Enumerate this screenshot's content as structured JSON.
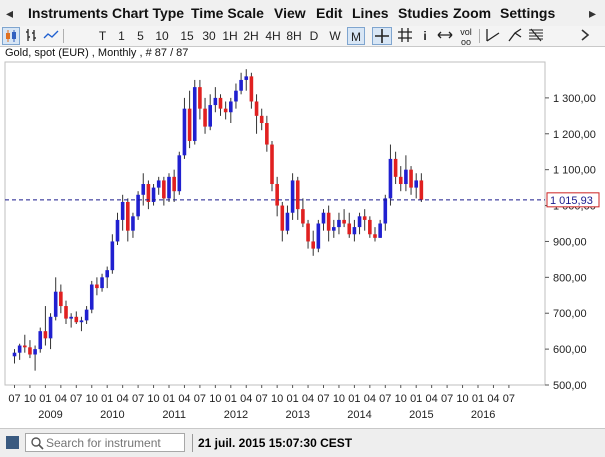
{
  "menu": {
    "items": [
      "Instruments",
      "Chart Type",
      "Time Scale",
      "View",
      "Edit",
      "Lines",
      "Studies",
      "Zoom",
      "Settings"
    ],
    "scroll_arrows": [
      "◂",
      "▸"
    ]
  },
  "toolbar": {
    "periods": [
      "T",
      "1",
      "5",
      "10",
      "15",
      "30",
      "1H",
      "2H",
      "4H",
      "8H",
      "D",
      "W",
      "M"
    ],
    "active_period": "M",
    "icons": [
      "candlestick-icon",
      "ohlc-icon",
      "line-chart-icon",
      "crosshair-icon",
      "grid-icon",
      "info-icon",
      "pan-icon",
      "volume-icon",
      "trend-line-icon",
      "fork-icon",
      "fibonacci-icon",
      "more-icon"
    ]
  },
  "chart_title": "Gold, spot (EUR) , Monthly , # 87 / 87",
  "status": {
    "search_placeholder": "Search for instrument",
    "datetime": "21 juil. 2015 15:07:30 CEST"
  },
  "colors": {
    "up": "#2020d0",
    "down": "#e02020",
    "last_price_line": "#1a1a8c",
    "last_price_box": "#cc2222"
  },
  "chart_data": {
    "type": "candlestick",
    "title": "Gold, spot (EUR) , Monthly , # 87 / 87",
    "ylim": [
      500,
      1400
    ],
    "y_ticks": [
      500,
      600,
      700,
      800,
      900,
      1000,
      1100,
      1200,
      1300
    ],
    "y_tick_labels": [
      "500,00",
      "600,00",
      "700,00",
      "800,00",
      "900,00",
      "1 000,00",
      "1 100,00",
      "1 200,00",
      "1 300,00"
    ],
    "x_month_labels": [
      "07",
      "10",
      "01",
      "04",
      "07",
      "10",
      "01",
      "04",
      "07",
      "10",
      "01",
      "04",
      "07",
      "10",
      "01",
      "04",
      "07",
      "10",
      "01",
      "04",
      "07",
      "10",
      "01",
      "04",
      "07",
      "10",
      "01",
      "04",
      "07",
      "10",
      "01",
      "04",
      "07"
    ],
    "x_year_labels": [
      {
        "label": "2009",
        "month_index": 7
      },
      {
        "label": "2010",
        "month_index": 19
      },
      {
        "label": "2011",
        "month_index": 31
      },
      {
        "label": "2012",
        "month_index": 43
      },
      {
        "label": "2013",
        "month_index": 55
      },
      {
        "label": "2014",
        "month_index": 67
      },
      {
        "label": "2015",
        "month_index": 79
      },
      {
        "label": "2016",
        "month_index": 91
      }
    ],
    "first_month_index": 0,
    "last_price": 1015.93,
    "last_price_label": "1 015,93",
    "ohlc": [
      [
        580,
        600,
        560,
        590
      ],
      [
        590,
        615,
        570,
        610
      ],
      [
        610,
        640,
        590,
        605
      ],
      [
        605,
        625,
        575,
        585
      ],
      [
        585,
        610,
        540,
        600
      ],
      [
        600,
        660,
        590,
        650
      ],
      [
        650,
        720,
        610,
        630
      ],
      [
        630,
        700,
        600,
        690
      ],
      [
        690,
        800,
        680,
        760
      ],
      [
        760,
        780,
        700,
        720
      ],
      [
        720,
        735,
        670,
        685
      ],
      [
        685,
        700,
        660,
        690
      ],
      [
        690,
        705,
        670,
        675
      ],
      [
        675,
        690,
        650,
        680
      ],
      [
        680,
        720,
        670,
        710
      ],
      [
        710,
        790,
        700,
        780
      ],
      [
        780,
        800,
        750,
        770
      ],
      [
        770,
        810,
        760,
        800
      ],
      [
        800,
        830,
        770,
        820
      ],
      [
        820,
        920,
        810,
        900
      ],
      [
        900,
        980,
        890,
        960
      ],
      [
        960,
        1030,
        930,
        1010
      ],
      [
        1010,
        1020,
        900,
        930
      ],
      [
        930,
        980,
        910,
        970
      ],
      [
        970,
        1040,
        960,
        1030
      ],
      [
        1030,
        1090,
        1000,
        1060
      ],
      [
        1060,
        1070,
        990,
        1010
      ],
      [
        1010,
        1060,
        1000,
        1050
      ],
      [
        1050,
        1080,
        1030,
        1070
      ],
      [
        1070,
        1080,
        1000,
        1020
      ],
      [
        1020,
        1090,
        1010,
        1080
      ],
      [
        1080,
        1100,
        1010,
        1040
      ],
      [
        1040,
        1150,
        1030,
        1140
      ],
      [
        1140,
        1300,
        1130,
        1270
      ],
      [
        1270,
        1320,
        1160,
        1180
      ],
      [
        1180,
        1350,
        1170,
        1330
      ],
      [
        1330,
        1350,
        1240,
        1270
      ],
      [
        1270,
        1300,
        1200,
        1220
      ],
      [
        1220,
        1310,
        1210,
        1280
      ],
      [
        1280,
        1330,
        1260,
        1300
      ],
      [
        1300,
        1310,
        1250,
        1270
      ],
      [
        1270,
        1290,
        1240,
        1260
      ],
      [
        1260,
        1300,
        1230,
        1290
      ],
      [
        1290,
        1340,
        1270,
        1320
      ],
      [
        1320,
        1370,
        1310,
        1350
      ],
      [
        1350,
        1380,
        1320,
        1360
      ],
      [
        1360,
        1370,
        1270,
        1290
      ],
      [
        1290,
        1310,
        1200,
        1250
      ],
      [
        1250,
        1270,
        1210,
        1230
      ],
      [
        1230,
        1250,
        1150,
        1170
      ],
      [
        1170,
        1180,
        1040,
        1060
      ],
      [
        1060,
        1080,
        970,
        1000
      ],
      [
        1000,
        1010,
        900,
        930
      ],
      [
        930,
        1000,
        920,
        980
      ],
      [
        980,
        1090,
        960,
        1070
      ],
      [
        1070,
        1080,
        960,
        990
      ],
      [
        990,
        1020,
        940,
        950
      ],
      [
        950,
        960,
        880,
        900
      ],
      [
        900,
        930,
        860,
        880
      ],
      [
        880,
        960,
        870,
        950
      ],
      [
        950,
        990,
        930,
        980
      ],
      [
        980,
        1000,
        900,
        930
      ],
      [
        930,
        960,
        910,
        940
      ],
      [
        940,
        980,
        920,
        960
      ],
      [
        960,
        990,
        940,
        950
      ],
      [
        950,
        980,
        910,
        920
      ],
      [
        920,
        960,
        900,
        940
      ],
      [
        940,
        980,
        920,
        970
      ],
      [
        970,
        990,
        930,
        960
      ],
      [
        960,
        970,
        910,
        920
      ],
      [
        920,
        940,
        900,
        910
      ],
      [
        910,
        960,
        910,
        950
      ],
      [
        950,
        1030,
        930,
        1020
      ],
      [
        1020,
        1170,
        1000,
        1130
      ],
      [
        1130,
        1150,
        1060,
        1080
      ],
      [
        1080,
        1110,
        1040,
        1060
      ],
      [
        1060,
        1140,
        1040,
        1100
      ],
      [
        1100,
        1110,
        1030,
        1050
      ],
      [
        1050,
        1090,
        1020,
        1070
      ],
      [
        1070,
        1090,
        1010,
        1016
      ]
    ]
  }
}
